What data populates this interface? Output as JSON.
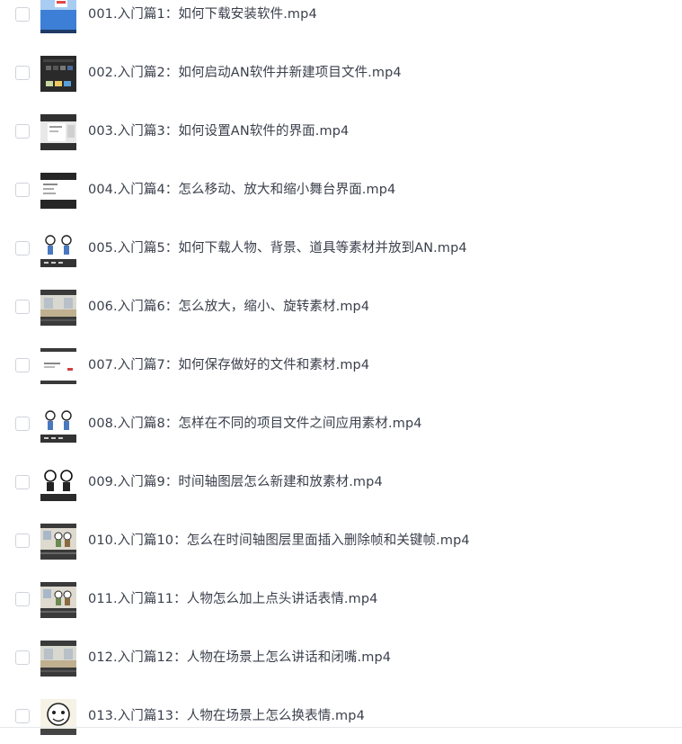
{
  "files": [
    {
      "name": "001.入门篇1：如何下载安装软件.mp4",
      "thumb": "blue-desktop"
    },
    {
      "name": "002.入门篇2：如何启动AN软件并新建项目文件.mp4",
      "thumb": "dark-app"
    },
    {
      "name": "003.入门篇3：如何设置AN软件的界面.mp4",
      "thumb": "dialog"
    },
    {
      "name": "004.入门篇4：怎么移动、放大和缩小舞台界面.mp4",
      "thumb": "stage"
    },
    {
      "name": "005.入门篇5：如何下载人物、背景、道具等素材并放到AN.mp4",
      "thumb": "characters"
    },
    {
      "name": "006.入门篇6：怎么放大，缩小、旋转素材.mp4",
      "thumb": "room"
    },
    {
      "name": "007.入门篇7：如何保存做好的文件和素材.mp4",
      "thumb": "white-page"
    },
    {
      "name": "008.入门篇8：怎样在不同的项目文件之间应用素材.mp4",
      "thumb": "characters"
    },
    {
      "name": "009.入门篇9：时间轴图层怎么新建和放素材.mp4",
      "thumb": "characters-dark"
    },
    {
      "name": "010.入门篇10：怎么在时间轴图层里面插入删除帧和关键帧.mp4",
      "thumb": "room-people"
    },
    {
      "name": "011.入门篇11：人物怎么加上点头讲话表情.mp4",
      "thumb": "room-people"
    },
    {
      "name": "012.入门篇12：人物在场景上怎么讲话和闭嘴.mp4",
      "thumb": "room"
    },
    {
      "name": "013.入门篇13：人物在场景上怎么换表情.mp4",
      "thumb": "face"
    }
  ]
}
